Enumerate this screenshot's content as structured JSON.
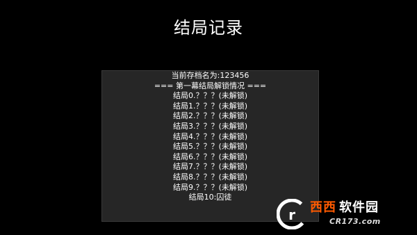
{
  "page": {
    "title": "结局记录"
  },
  "records": {
    "save_name_line": "当前存档名为:123456",
    "section_header": "=== 第一幕结局解锁情况 ===",
    "endings": [
      "结局0.？？？(未解锁)",
      "结局1.？？？(未解锁)",
      "结局2.？？？(未解锁)",
      "结局3.？？？(未解锁)",
      "结局4.？？？(未解锁)",
      "结局5.？？？(未解锁)",
      "结局6.？？？(未解锁)",
      "结局7.？？？(未解锁)",
      "结局8.？？？(未解锁)",
      "结局9.？？？(未解锁)",
      "结局10:囚徒"
    ]
  },
  "watermark": {
    "accent_text": "西西",
    "main_text": "软件园",
    "domain_text": "CR173.com",
    "accent_color": "#ff5a00"
  }
}
